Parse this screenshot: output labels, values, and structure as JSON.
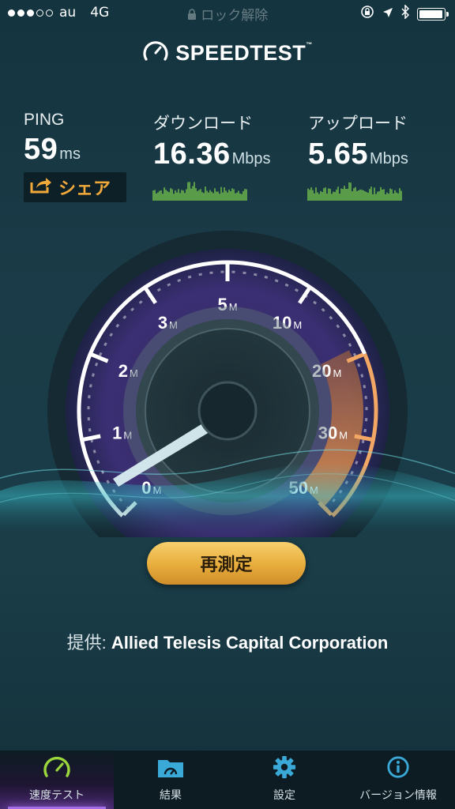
{
  "status_bar": {
    "carrier": "au",
    "network": "4G",
    "signal_bars_filled": 3,
    "signal_bars_total": 5,
    "center_text": "ロック解除",
    "battery_level": 0.95
  },
  "app": {
    "logo_text": "SPEEDTEST",
    "logo_tm": "™"
  },
  "stats": {
    "ping": {
      "label": "PING",
      "value": "59",
      "unit": "ms"
    },
    "download": {
      "label": "ダウンロード",
      "value": "16.36",
      "unit": "Mbps"
    },
    "upload": {
      "label": "アップロード",
      "value": "5.65",
      "unit": "Mbps"
    }
  },
  "share_button": {
    "label": "シェア",
    "icon": "share-icon"
  },
  "gauge": {
    "ticks": [
      {
        "value": "0",
        "unit": "M"
      },
      {
        "value": "1",
        "unit": "M"
      },
      {
        "value": "2",
        "unit": "M"
      },
      {
        "value": "3",
        "unit": "M"
      },
      {
        "value": "5",
        "unit": "M"
      },
      {
        "value": "10",
        "unit": "M"
      },
      {
        "value": "20",
        "unit": "M"
      },
      {
        "value": "30",
        "unit": "M"
      },
      {
        "value": "50",
        "unit": "M"
      }
    ],
    "colors": {
      "purple": "#8c5de0",
      "orange": "#e9964a",
      "needle": "#d9eef2"
    }
  },
  "retest_button": {
    "label": "再測定"
  },
  "provider": {
    "prefix": "提供:",
    "name": "Allied Telesis Capital Corporation"
  },
  "tab_bar": {
    "tabs": [
      {
        "label": "速度テスト",
        "icon": "speedometer-icon",
        "active": true
      },
      {
        "label": "結果",
        "icon": "folder-results-icon",
        "active": false
      },
      {
        "label": "設定",
        "icon": "gear-icon",
        "active": false
      },
      {
        "label": "バージョン情報",
        "icon": "info-icon",
        "active": false
      }
    ]
  },
  "colors": {
    "accent": "#f0a93a",
    "tab_active": "#a36ce8",
    "spark_green": "#7fd14d"
  }
}
